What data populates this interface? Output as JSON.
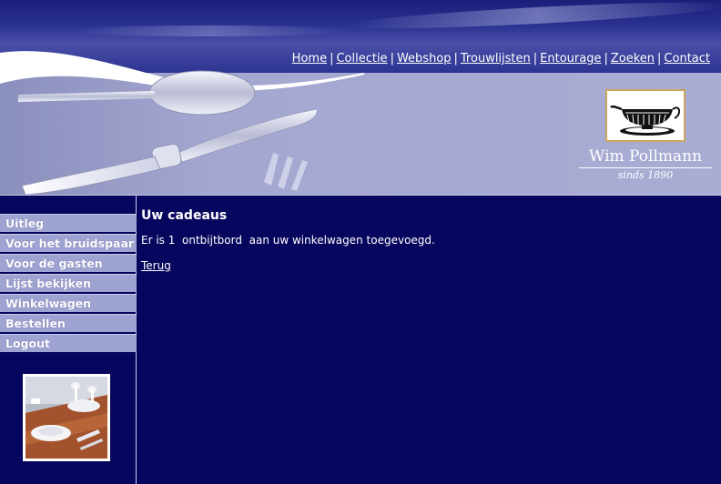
{
  "nav": {
    "items": [
      "Home",
      "Collectie",
      "Webshop",
      "Trouwlijsten",
      "Entourage",
      "Zoeken",
      "Contact"
    ],
    "separator": "|"
  },
  "brand": {
    "name": "Wim Pollmann",
    "since": "sinds 1890"
  },
  "sidebar": {
    "items": [
      "Uitleg",
      "Voor het bruidspaar",
      "Voor de gasten",
      "Lijst bekijken",
      "Winkelwagen",
      "Bestellen",
      "Logout"
    ]
  },
  "main": {
    "title": "Uw cadeaus",
    "message_prefix": "Er is 1",
    "message_item": "ontbijtbord",
    "message_suffix": "aan uw winkelwagen toegevoegd.",
    "back_label": "Terug"
  },
  "colors": {
    "background": "#07065e",
    "menu": "#9fa3d1",
    "header_light": "#a9acd3"
  }
}
